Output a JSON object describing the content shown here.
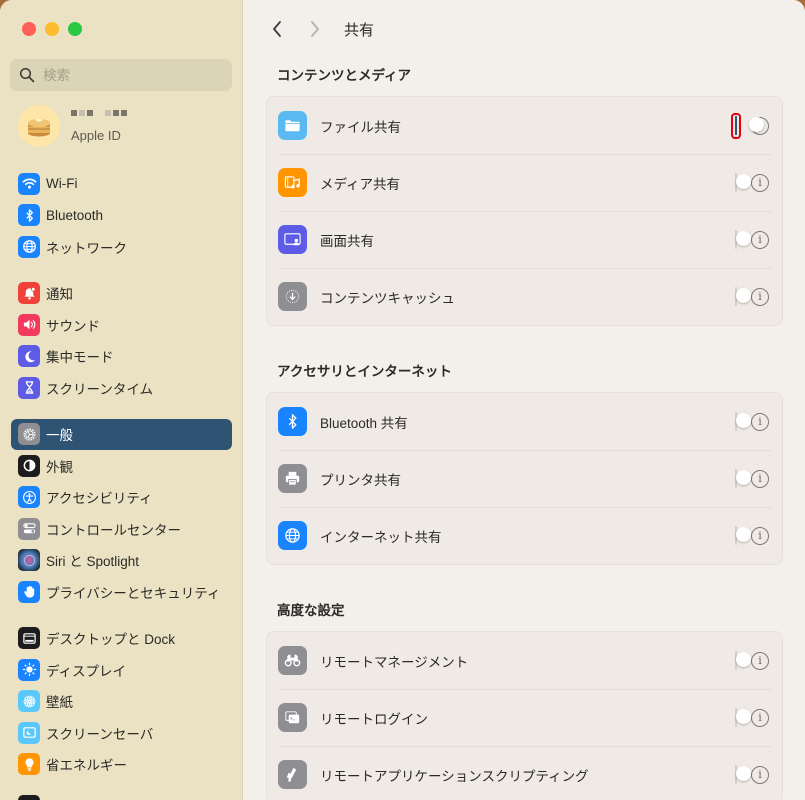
{
  "window": {
    "traffic_lights": [
      "close",
      "minimize",
      "maximize"
    ]
  },
  "sidebar": {
    "search_placeholder": "検索",
    "account": {
      "name_obscured": true,
      "subtitle": "Apple ID"
    },
    "groups": [
      [
        {
          "label": "Wi-Fi",
          "icon": "wifi-icon",
          "color": "#1a84ff"
        },
        {
          "label": "Bluetooth",
          "icon": "bluetooth-icon",
          "color": "#1a84ff"
        },
        {
          "label": "ネットワーク",
          "icon": "globe-icon",
          "color": "#1a84ff"
        }
      ],
      [
        {
          "label": "通知",
          "icon": "bell-icon",
          "color": "#f0423a"
        },
        {
          "label": "サウンド",
          "icon": "speaker-icon",
          "color": "#f23a5e"
        },
        {
          "label": "集中モード",
          "icon": "moon-icon",
          "color": "#5e5ce6"
        },
        {
          "label": "スクリーンタイム",
          "icon": "hourglass-icon",
          "color": "#5e5ce6"
        }
      ],
      [
        {
          "label": "一般",
          "icon": "gear-icon",
          "color": "#8e8e93",
          "active": true
        },
        {
          "label": "外観",
          "icon": "appearance-icon",
          "color": "#1c1c1e"
        },
        {
          "label": "アクセシビリティ",
          "icon": "accessibility-icon",
          "color": "#1a84ff"
        },
        {
          "label": "コントロールセンター",
          "icon": "control-center-icon",
          "color": "#8e8e93"
        },
        {
          "label": "Siri と Spotlight",
          "icon": "siri-icon",
          "color": "#3a2f4a"
        },
        {
          "label": "プライバシーとセキュリティ",
          "icon": "hand-icon",
          "color": "#1a84ff"
        }
      ],
      [
        {
          "label": "デスクトップと Dock",
          "icon": "dock-icon",
          "color": "#1c1c1e"
        },
        {
          "label": "ディスプレイ",
          "icon": "sun-icon",
          "color": "#1a84ff"
        },
        {
          "label": "壁紙",
          "icon": "flower-icon",
          "color": "#5ac8fa"
        },
        {
          "label": "スクリーンセーバ",
          "icon": "screensaver-icon",
          "color": "#5ac8fa"
        },
        {
          "label": "省エネルギー",
          "icon": "lightbulb-icon",
          "color": "#ff9500"
        }
      ]
    ]
  },
  "main": {
    "title": "共有",
    "back_label": "戻る",
    "forward_label": "進む",
    "sections": [
      {
        "title": "コンテンツとメディア",
        "rows": [
          {
            "label": "ファイル共有",
            "icon": "folder-icon",
            "color": "#5ab9f0",
            "enabled": true,
            "highlighted": true
          },
          {
            "label": "メディア共有",
            "icon": "media-icon",
            "color": "#ff9500",
            "enabled": false
          },
          {
            "label": "画面共有",
            "icon": "screen-share-icon",
            "color": "#5e5ce6",
            "enabled": false
          },
          {
            "label": "コンテンツキャッシュ",
            "icon": "content-cache-icon",
            "color": "#8e8e93",
            "enabled": false
          }
        ]
      },
      {
        "title": "アクセサリとインターネット",
        "rows": [
          {
            "label": "Bluetooth 共有",
            "icon": "bluetooth-icon",
            "color": "#1a84ff",
            "enabled": false
          },
          {
            "label": "プリンタ共有",
            "icon": "printer-icon",
            "color": "#8e8e93",
            "enabled": false
          },
          {
            "label": "インターネット共有",
            "icon": "globe-icon",
            "color": "#1a84ff",
            "enabled": false
          }
        ]
      },
      {
        "title": "高度な設定",
        "rows": [
          {
            "label": "リモートマネージメント",
            "icon": "binoculars-icon",
            "color": "#8e8e93",
            "enabled": false
          },
          {
            "label": "リモートログイン",
            "icon": "terminal-icon",
            "color": "#8e8e93",
            "enabled": false
          },
          {
            "label": "リモートアプリケーションスクリプティング",
            "icon": "script-icon",
            "color": "#8e8e93",
            "enabled": false
          }
        ]
      }
    ],
    "info_glyph": "i"
  }
}
